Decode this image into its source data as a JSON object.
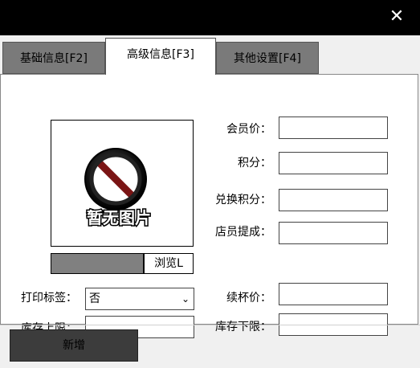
{
  "window": {
    "close_glyph": "✕"
  },
  "tabs": [
    {
      "label": "基础信息[F2]",
      "active": false
    },
    {
      "label": "高级信息[F3]",
      "active": true
    },
    {
      "label": "其他设置[F4]",
      "active": false
    }
  ],
  "image": {
    "caption": "暂无图片",
    "icon": "no-image-icon"
  },
  "browse": {
    "label": "浏览L"
  },
  "fields": {
    "member_price": {
      "label": "会员价：",
      "value": ""
    },
    "points": {
      "label": "积分：",
      "value": ""
    },
    "redeem_points": {
      "label": "兑换积分：",
      "value": ""
    },
    "staff_commission": {
      "label": "店员提成：",
      "value": ""
    },
    "refill_price": {
      "label": "续杯价：",
      "value": ""
    },
    "stock_upper": {
      "label": "库存上限：",
      "value": ""
    },
    "stock_lower": {
      "label": "库存下限：",
      "value": ""
    }
  },
  "print_label": {
    "label": "打印标签：",
    "selected": "否"
  },
  "footer": {
    "add_label": "新增"
  }
}
